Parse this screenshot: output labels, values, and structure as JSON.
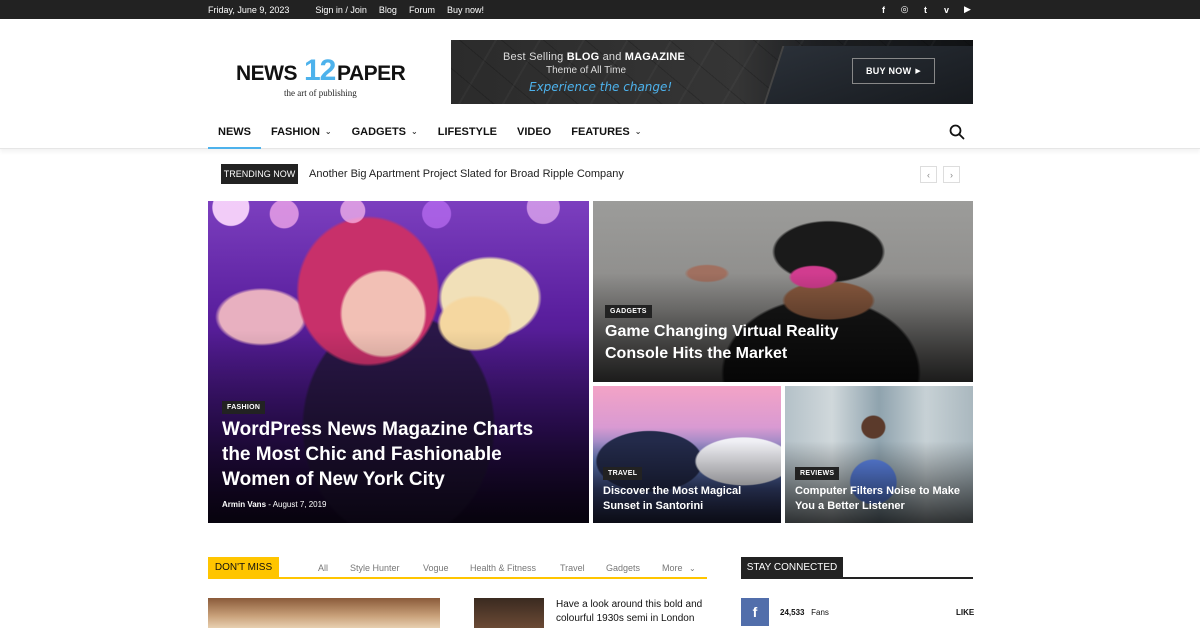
{
  "topbar": {
    "date": "Friday, June 9, 2023",
    "links": [
      "Sign in / Join",
      "Blog",
      "Forum",
      "Buy now!"
    ],
    "social_icons": [
      "facebook-icon",
      "instagram-icon",
      "twitter-icon",
      "vimeo-icon",
      "youtube-icon"
    ],
    "social_glyphs": [
      "f",
      "◎",
      "t",
      "v",
      "▶"
    ]
  },
  "logo": {
    "word_left": "NEWS",
    "number": "12",
    "word_right": "PAPER",
    "tagline": "the art of publishing",
    "accent_color": "#4db2ec"
  },
  "banner": {
    "line1_prefix": "Best Selling ",
    "line1_bold1": "BLOG",
    "line1_mid": " and ",
    "line1_bold2": "MAGAZINE",
    "line2": "Theme of All Time",
    "line3": "Experience the change!",
    "button": "BUY NOW"
  },
  "nav": {
    "items": [
      {
        "label": "NEWS",
        "dropdown": false
      },
      {
        "label": "FASHION",
        "dropdown": true
      },
      {
        "label": "GADGETS",
        "dropdown": true
      },
      {
        "label": "LIFESTYLE",
        "dropdown": false
      },
      {
        "label": "VIDEO",
        "dropdown": false
      },
      {
        "label": "FEATURES",
        "dropdown": true
      }
    ]
  },
  "trending": {
    "label": "TRENDING NOW",
    "headline": "Another Big Apartment Project Slated for Broad Ripple Company",
    "prev": "‹",
    "next": "›"
  },
  "hero": {
    "main": {
      "category": "FASHION",
      "title": "WordPress News Magazine Charts the Most Chic and Fashionable Women of New York City",
      "author": "Armin Vans",
      "date": "August 7, 2019"
    },
    "top_right": {
      "category": "GADGETS",
      "title": "Game Changing Virtual Reality Console Hits the Market"
    },
    "bottom_left": {
      "category": "TRAVEL",
      "title": "Discover the Most Magical Sunset in Santorini"
    },
    "bottom_right": {
      "category": "REVIEWS",
      "title": "Computer Filters Noise to Make You a Better Listener"
    }
  },
  "dont_miss": {
    "label": "DON'T MISS",
    "tabs": [
      "All",
      "Style Hunter",
      "Vogue",
      "Health & Fitness",
      "Travel",
      "Gadgets",
      "More"
    ],
    "accent_color": "#ffc500",
    "article_title": "Have a look around this bold and colourful 1930s semi in London"
  },
  "stay_connected": {
    "label": "STAY CONNECTED",
    "facebook": {
      "count": "24,533",
      "unit": "Fans",
      "action": "LIKE",
      "color": "#516eab"
    }
  }
}
